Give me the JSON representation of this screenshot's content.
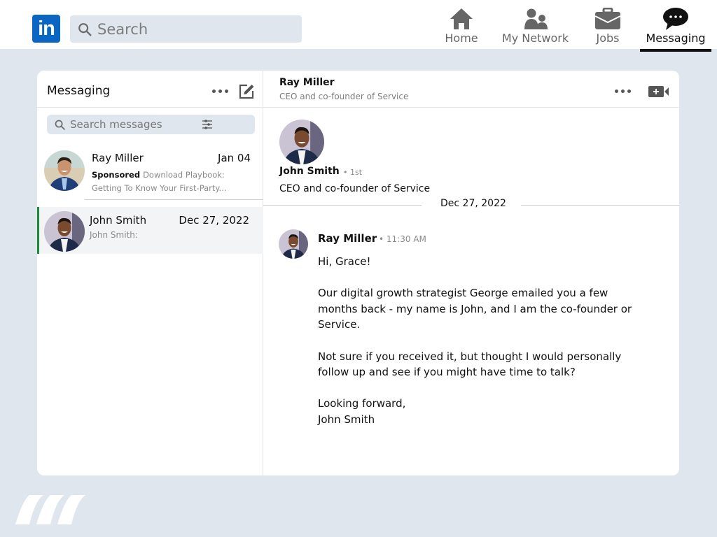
{
  "topbar": {
    "logo_text": "in",
    "search_placeholder": "Search",
    "nav": [
      {
        "label": "Home",
        "icon": "home-icon"
      },
      {
        "label": "My Network",
        "icon": "people-icon"
      },
      {
        "label": "Jobs",
        "icon": "briefcase-icon"
      },
      {
        "label": "Messaging",
        "icon": "chat-bubble-icon",
        "active": true
      }
    ]
  },
  "sidebar": {
    "title": "Messaging",
    "search_placeholder": "Search messages",
    "conversations": [
      {
        "name": "Ray Miller",
        "date": "Jan 04",
        "sponsored_label": "Sponsored",
        "snippet": "Download Playbook: Getting To Know Your First-Party..."
      },
      {
        "name": "John Smith",
        "date": "Dec 27, 2022",
        "preview": "John Smith:",
        "selected": true
      }
    ]
  },
  "chat": {
    "header": {
      "name": "Ray Miller",
      "subtitle": "CEO and co-founder of Service"
    },
    "profile": {
      "name": "John Smith",
      "degree": "• 1st",
      "title": "CEO and co-founder of Service"
    },
    "date_separator": "Dec 27, 2022",
    "message": {
      "sender": "Ray Miller",
      "time": "• 11:30 AM",
      "paragraphs": [
        "Hi, Grace!",
        "Our digital growth strategist George emailed you a few months back - my name is John, and I am the co-founder or Service.",
        "Not sure if you received it, but thought I would personally follow up and see if you might have time to talk?",
        "Looking forward,\nJohn Smith"
      ]
    }
  },
  "colors": {
    "brand": "#0a66c2",
    "background": "#dfe6ed",
    "selected_indicator": "#1e8a3a"
  }
}
